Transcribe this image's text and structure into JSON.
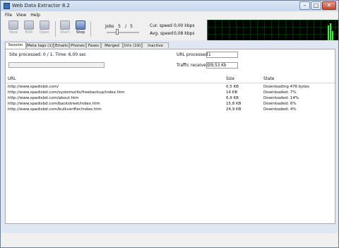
{
  "window": {
    "title": "Web Data Extractor 8.2",
    "buttons": [
      "–",
      "□",
      "✕"
    ]
  },
  "menu": [
    "File",
    "View",
    "Help"
  ],
  "toolbar": {
    "tools": [
      {
        "label": "New",
        "icon": "new-icon",
        "enabled": false
      },
      {
        "label": "Edit",
        "icon": "edit-icon",
        "enabled": false
      },
      {
        "label": "Open",
        "icon": "open-icon",
        "enabled": false
      },
      {
        "label": "Start",
        "icon": "start-icon",
        "enabled": false
      },
      {
        "label": "Stop",
        "icon": "stop-icon",
        "enabled": true
      }
    ],
    "jobs_label": "Jobs",
    "jobs_current": "5",
    "jobs_separator": "/",
    "jobs_max": "5",
    "cur_speed_label": "Cur. speed",
    "cur_speed": "0,00 kbps",
    "avg_speed_label": "Avg. speed",
    "avg_speed": "0,08 kbps"
  },
  "tabs": [
    "Session",
    "Meta tags (1)",
    "Emails",
    "Phones",
    "Faxes",
    "Merged list",
    "Urls (19)",
    "Inactive sites"
  ],
  "active_tab": 0,
  "session": {
    "status": "Site processed: 0 / 1. Time: 6,00 sec",
    "progress": 0,
    "url_processed_label": "URL processed",
    "url_processed": "1",
    "traffic_label": "Traffic received",
    "traffic": "39,53 Kb"
  },
  "table": {
    "headers": [
      "URL",
      "Size",
      "State"
    ],
    "rows": [
      {
        "url": "http://www.spadixbd.com/",
        "size": "0,5 KB",
        "state": "Downloading 476 bytes"
      },
      {
        "url": "http://www.spadixbd.com/systemutils/freebackup/index.htm",
        "size": "14 KB",
        "state": "Downloaded: 7%"
      },
      {
        "url": "http://www.spadixbd.com/about.htm",
        "size": "6,9 KB",
        "state": "Downloaded: 14%"
      },
      {
        "url": "http://www.spadixbd.com/backstreet/index.htm",
        "size": "15,8 KB",
        "state": "Downloaded: 6%"
      },
      {
        "url": "http://www.spadixbd.com/bulkverifier/index.htm",
        "size": "24,9 KB",
        "state": "Downloaded: 4%"
      }
    ]
  }
}
